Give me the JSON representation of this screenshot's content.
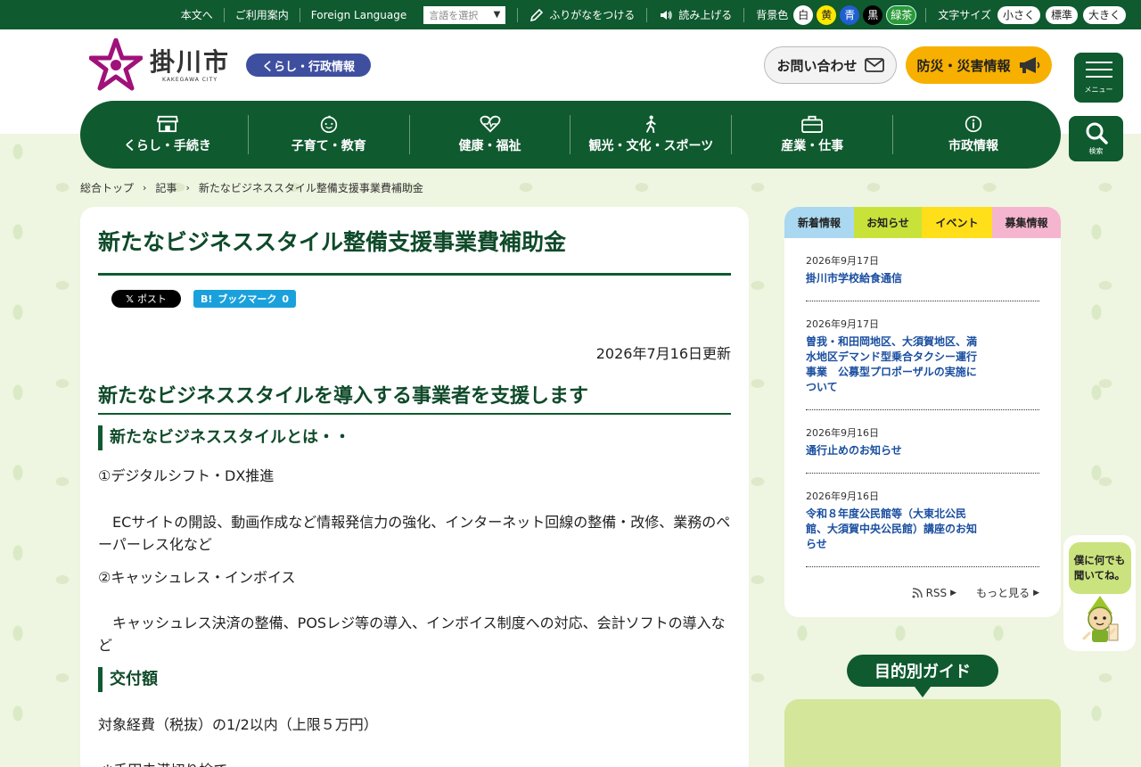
{
  "utility_bar": {
    "skip_link": "本文へ",
    "usage_guide": "ご利用案内",
    "foreign_language": "Foreign Language",
    "language_select_placeholder": "言語を選択",
    "furigana": "ふりがなをつける",
    "read_aloud": "読み上げる",
    "background_color_label": "背景色",
    "bg_colors": [
      "白",
      "黄",
      "青",
      "黒",
      "緑茶"
    ],
    "font_size_label": "文字サイズ",
    "font_sizes": [
      "小さく",
      "標準",
      "大きく"
    ]
  },
  "header": {
    "logo_text": "掛川市",
    "logo_sub": "KAKEGAWA CITY",
    "section_badge": "くらし・行政情報",
    "contact_button": "お問い合わせ",
    "disaster_button": "防災・災害情報",
    "menu_label": "メニュー",
    "search_label": "検索"
  },
  "global_nav": [
    {
      "label": "くらし・手続き",
      "icon": "shop-icon"
    },
    {
      "label": "子育て・教育",
      "icon": "baby-face-icon"
    },
    {
      "label": "健康・福祉",
      "icon": "heart-pulse-icon"
    },
    {
      "label": "観光・文化・スポーツ",
      "icon": "walking-person-icon"
    },
    {
      "label": "産業・仕事",
      "icon": "briefcase-icon"
    },
    {
      "label": "市政情報",
      "icon": "info-icon"
    }
  ],
  "breadcrumb": [
    "総合トップ",
    "記事",
    "新たなビジネススタイル整備支援事業費補助金"
  ],
  "article": {
    "title": "新たなビジネススタイル整備支援事業費補助金",
    "share_x": "ポスト",
    "share_hatena": "ブックマーク",
    "hatena_count": "0",
    "updated": "2026年7月16日更新",
    "heading_main": "新たなビジネススタイルを導入する事業者を支援します",
    "heading_what": "新たなビジネススタイルとは・・",
    "item1_title": "①デジタルシフト・DX推進",
    "item1_desc": "ECサイトの開設、動画作成など情報発信力の強化、インターネット回線の整備・改修、業務のペーパーレス化など",
    "item2_title": "②キャッシュレス・インボイス",
    "item2_desc": "キャッシュレス決済の整備、POSレジ等の導入、インボイス制度への対応、会計ソフトの導入など",
    "heading_amount": "交付額",
    "amount_text": "対象経費（税抜）の1/2以内（上限５万円）",
    "amount_note": "※千円未満切り捨て"
  },
  "news": {
    "tabs": [
      "新着情報",
      "お知らせ",
      "イベント",
      "募集情報"
    ],
    "items": [
      {
        "date": "2026年9月17日",
        "title": "掛川市学校給食通信"
      },
      {
        "date": "2026年9月17日",
        "title": "曽我・和田岡地区、大須賀地区、満水地区デマンド型乗合タクシー運行事業　公募型プロポーザルの実施について"
      },
      {
        "date": "2026年9月16日",
        "title": "通行止めのお知らせ"
      },
      {
        "date": "2026年9月16日",
        "title": "令和８年度公民館等（大東北公民館、大須賀中央公民館）講座のお知らせ"
      }
    ],
    "rss_label": "RSS",
    "more_label": "もっと見る"
  },
  "guide": {
    "label": "目的別ガイド"
  },
  "mascot": {
    "line1": "僕に何でも",
    "line2": "聞いてね。"
  },
  "colors": {
    "brand_green": "#0f5a2f",
    "badge_blue": "#3f4fa0",
    "disaster_orange": "#f7b000",
    "link_blue": "#1a4ea0"
  }
}
